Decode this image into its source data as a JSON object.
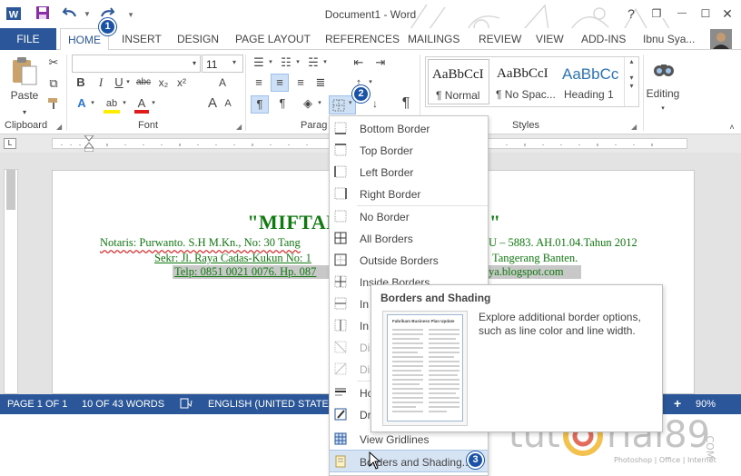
{
  "window": {
    "title": "Document1 - Word"
  },
  "window_controls": {
    "help": "?",
    "restore": "❐",
    "minimize": "—",
    "maximize": "☐",
    "close": "✕"
  },
  "quick_access": {
    "word_icon": "W"
  },
  "tabs": [
    "FILE",
    "HOME",
    "INSERT",
    "DESIGN",
    "PAGE LAYOUT",
    "REFERENCES",
    "MAILINGS",
    "REVIEW",
    "VIEW",
    "ADD-INS"
  ],
  "user": {
    "name": "Ibnu Sya..."
  },
  "ribbon": {
    "clipboard": {
      "label": "Clipboard",
      "paste": "Paste"
    },
    "font": {
      "label": "Font",
      "font_size": "11",
      "bold": "B",
      "italic": "I",
      "underline": "U",
      "strike": "abc",
      "subscript": "x₂",
      "superscript": "x²",
      "effects": "A",
      "highlight": "ab",
      "color": "A",
      "grow": "A",
      "shrink": "A",
      "clear": "A"
    },
    "paragraph": {
      "label": "Parag",
      "pilcrow": "¶"
    },
    "styles": {
      "label": "Styles",
      "items": [
        {
          "preview": "AaBbCcI",
          "name": "¶ Normal"
        },
        {
          "preview": "AaBbCcI",
          "name": "¶ No Spac..."
        },
        {
          "preview": "AaBbCc",
          "name": "Heading 1"
        }
      ]
    },
    "editing": {
      "label": "Editing"
    }
  },
  "document": {
    "title": "\"MIFTAHUL HU          AHAYA)\"",
    "line1_left": "Notaris: Purwanto. S.H M.Kn., No: 30 Tang",
    "line1_right": "U – 5883. AH.01.04.Tahun 2012",
    "line2_left": "Sekr: Jl. Raya Cadas-Kukun No: 1",
    "line2_right": "Tangerang Banten.",
    "line3_left": "Telp: 0851 0021 0076. Hp. 087",
    "line3_right": "ya.blogspot.com"
  },
  "border_menu": {
    "items": [
      "Bottom Border",
      "Top Border",
      "Left Border",
      "Right Border",
      "No Border",
      "All Borders",
      "Outside Borders",
      "Inside Borders",
      "In",
      "In",
      "Di",
      "Di",
      "Ho",
      "Dr",
      "View Gridlines",
      "Borders and Shading..."
    ]
  },
  "tooltip": {
    "title": "Borders and Shading",
    "description": "Explore additional border options, such as line color and line width.",
    "thumb_title": "Fabrikam Business Plan Update"
  },
  "status_bar": {
    "page": "PAGE 1 OF 1",
    "words": "10 OF 43 WORDS",
    "language": "ENGLISH (UNITED STATES)",
    "zoom": "90%",
    "zoom_plus": "+"
  },
  "badges": [
    "1",
    "2",
    "3"
  ],
  "watermark": {
    "brand_left": "tut",
    "brand_right": "rial89",
    "tagline": "Photoshop | Office | Internet",
    "com": ".COM"
  },
  "colors": {
    "accent": "#2b579a",
    "document_green": "#0f7a0f",
    "badge": "#1a52a8"
  }
}
